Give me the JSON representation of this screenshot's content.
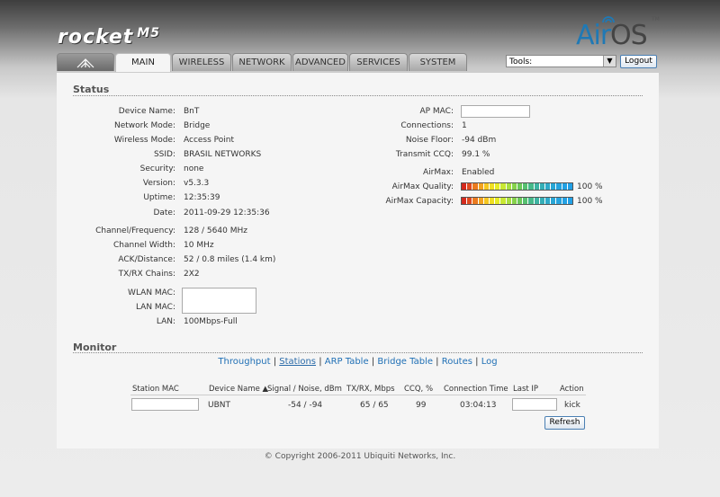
{
  "brand": {
    "product": "rocket",
    "model": "M5",
    "os_prefix": "Air",
    "os_suffix": "OS",
    "trademark": "TM",
    "accent": "#1f79b5"
  },
  "tabs": [
    {
      "label": ""
    },
    {
      "label": "MAIN"
    },
    {
      "label": "WIRELESS"
    },
    {
      "label": "NETWORK"
    },
    {
      "label": "ADVANCED"
    },
    {
      "label": "SERVICES"
    },
    {
      "label": "SYSTEM"
    }
  ],
  "toolbar": {
    "tools_value": "Tools:",
    "logout_label": "Logout"
  },
  "status": {
    "title": "Status",
    "left": [
      {
        "label": "Device Name:",
        "value": "BnT"
      },
      {
        "label": "Network Mode:",
        "value": "Bridge"
      },
      {
        "label": "Wireless Mode:",
        "value": "Access Point"
      },
      {
        "label": "SSID:",
        "value": "BRASIL NETWORKS"
      },
      {
        "label": "Security:",
        "value": "none"
      },
      {
        "label": "Version:",
        "value": "v5.3.3"
      },
      {
        "label": "Uptime:",
        "value": "12:35:39"
      },
      {
        "label": "Date:",
        "value": "2011-09-29 12:35:36"
      },
      {
        "label": "Channel/Frequency:",
        "value": "128 / 5640 MHz"
      },
      {
        "label": "Channel Width:",
        "value": "10 MHz"
      },
      {
        "label": "ACK/Distance:",
        "value": "52 / 0.8 miles (1.4 km)"
      },
      {
        "label": "TX/RX Chains:",
        "value": "2X2"
      },
      {
        "label": "WLAN MAC:",
        "value": ""
      },
      {
        "label": "LAN MAC:",
        "value": ""
      },
      {
        "label": "LAN:",
        "value": "100Mbps-Full"
      }
    ],
    "right": [
      {
        "label": "AP MAC:",
        "value": ""
      },
      {
        "label": "Connections:",
        "value": "1"
      },
      {
        "label": "Noise Floor:",
        "value": "-94 dBm"
      },
      {
        "label": "Transmit CCQ:",
        "value": "99.1 %"
      },
      {
        "label": "AirMax:",
        "value": "Enabled"
      },
      {
        "label": "AirMax Quality:",
        "value": "100 %",
        "level": 100
      },
      {
        "label": "AirMax Capacity:",
        "value": "100 %",
        "level": 100
      }
    ],
    "bar_colors": [
      "#d42a1e",
      "#e04a1f",
      "#ea7a1f",
      "#f2a320",
      "#f5c71f",
      "#f0df22",
      "#e5ec25",
      "#c9e832",
      "#a7df3f",
      "#86d24c",
      "#6bc85a",
      "#56c070",
      "#46b98a",
      "#3db3a1",
      "#34aeb6",
      "#2ea9c8",
      "#29a6d5",
      "#26a3de",
      "#23a1e3",
      "#21a0e6"
    ]
  },
  "monitor": {
    "title": "Monitor",
    "links": [
      "Throughput",
      "Stations",
      "ARP Table",
      "Bridge Table",
      "Routes",
      "Log"
    ],
    "separator": " | ",
    "table": {
      "headers": [
        "Station MAC",
        "Device Name ▲",
        "Signal / Noise, dBm",
        "TX/RX, Mbps",
        "CCQ, %",
        "Connection Time",
        "Last IP",
        "Action"
      ],
      "row": {
        "device_name": "UBNT",
        "signal_noise": "-54 / -94",
        "txrx": "65 / 65",
        "ccq": "99",
        "connection_time": "03:04:13",
        "action": "kick"
      }
    },
    "refresh_label": "Refresh"
  },
  "footer": {
    "copyright": "© Copyright 2006-2011 Ubiquiti Networks, Inc."
  }
}
